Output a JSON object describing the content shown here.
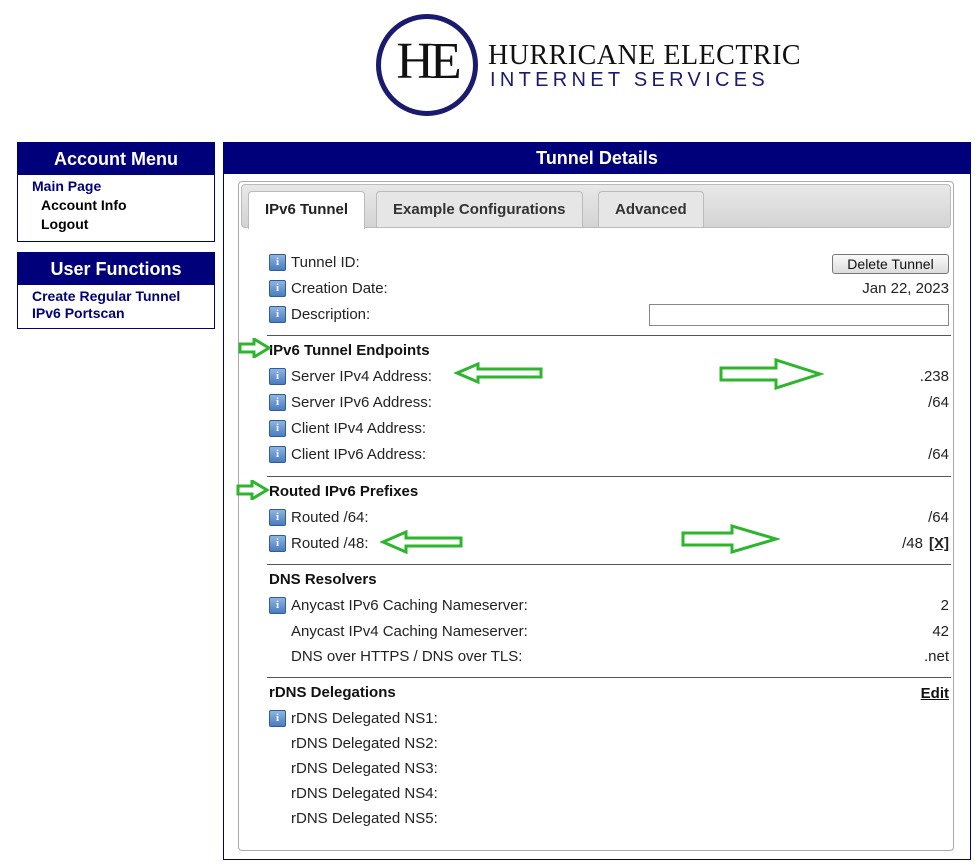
{
  "logo": {
    "monogram": "HE",
    "line1": "HURRICANE ELECTRIC",
    "line2": "INTERNET SERVICES"
  },
  "account_menu": {
    "title": "Account Menu",
    "items": [
      {
        "label": "Main Page"
      },
      {
        "label": "Account Info"
      },
      {
        "label": "Logout"
      }
    ]
  },
  "user_functions": {
    "title": "User Functions",
    "items": [
      {
        "label": "Create Regular Tunnel"
      },
      {
        "label": "IPv6 Portscan"
      }
    ]
  },
  "panel": {
    "title": "Tunnel Details",
    "tabs": [
      {
        "label": "IPv6 Tunnel",
        "active": true
      },
      {
        "label": "Example Configurations",
        "active": false
      },
      {
        "label": "Advanced",
        "active": false
      }
    ],
    "delete_button": "Delete Tunnel",
    "description_value": "",
    "fields": {
      "tunnel_id": {
        "label": "Tunnel ID:",
        "value": ""
      },
      "creation_date": {
        "label": "Creation Date:",
        "value": "Jan 22, 2023"
      },
      "description": {
        "label": "Description:"
      }
    },
    "endpoints": {
      "title": "IPv6 Tunnel Endpoints",
      "server_ipv4": {
        "label": "Server IPv4 Address:",
        "value": ".238"
      },
      "server_ipv6": {
        "label": "Server IPv6 Address:",
        "value": "/64"
      },
      "client_ipv4": {
        "label": "Client IPv4 Address:",
        "value": ""
      },
      "client_ipv6": {
        "label": "Client IPv6 Address:",
        "value": "/64"
      }
    },
    "prefixes": {
      "title": "Routed IPv6 Prefixes",
      "routed64": {
        "label": "Routed /64:",
        "value": "/64"
      },
      "routed48": {
        "label": "Routed /48:",
        "value": "/48",
        "remove": "[X]"
      }
    },
    "dns": {
      "title": "DNS Resolvers",
      "anycast_v6": {
        "label": "Anycast IPv6 Caching Nameserver:",
        "value": "2"
      },
      "anycast_v4": {
        "label": "Anycast IPv4 Caching Nameserver:",
        "value": "42"
      },
      "doh": {
        "label": "DNS over HTTPS / DNS over TLS:",
        "value": ".net"
      }
    },
    "rdns": {
      "title": "rDNS Delegations",
      "edit": "Edit",
      "ns1": "rDNS Delegated NS1:",
      "ns2": "rDNS Delegated NS2:",
      "ns3": "rDNS Delegated NS3:",
      "ns4": "rDNS Delegated NS4:",
      "ns5": "rDNS Delegated NS5:"
    }
  },
  "annotation_color": "#2db52d",
  "info_icon": "info-icon"
}
